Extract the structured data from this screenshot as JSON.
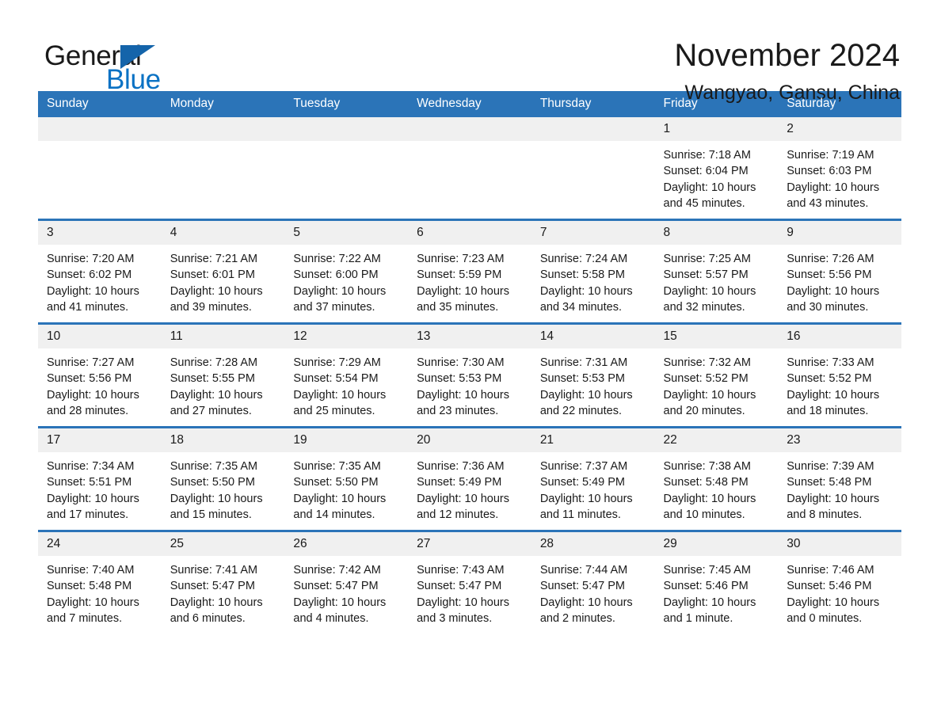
{
  "brand": {
    "word_one": "General",
    "word_two": "Blue",
    "triangle_color": "#1464aa",
    "blue_color": "#0b72c4",
    "icon": "triangle-logo-icon"
  },
  "header": {
    "title": "November 2024",
    "subtitle": "Wangyao, Gansu, China"
  },
  "theme": {
    "header_blue": "#2b74b8",
    "day_band_gray": "#f0f0f0",
    "text": "#1a1a1a"
  },
  "weekdays": [
    "Sunday",
    "Monday",
    "Tuesday",
    "Wednesday",
    "Thursday",
    "Friday",
    "Saturday"
  ],
  "weeks": [
    [
      {
        "day": "",
        "blank": true,
        "sunrise": "",
        "sunset": "",
        "daylight1": "",
        "daylight2": ""
      },
      {
        "day": "",
        "blank": true,
        "sunrise": "",
        "sunset": "",
        "daylight1": "",
        "daylight2": ""
      },
      {
        "day": "",
        "blank": true,
        "sunrise": "",
        "sunset": "",
        "daylight1": "",
        "daylight2": ""
      },
      {
        "day": "",
        "blank": true,
        "sunrise": "",
        "sunset": "",
        "daylight1": "",
        "daylight2": ""
      },
      {
        "day": "",
        "blank": true,
        "sunrise": "",
        "sunset": "",
        "daylight1": "",
        "daylight2": ""
      },
      {
        "day": "1",
        "blank": false,
        "sunrise": "Sunrise: 7:18 AM",
        "sunset": "Sunset: 6:04 PM",
        "daylight1": "Daylight: 10 hours",
        "daylight2": "and 45 minutes."
      },
      {
        "day": "2",
        "blank": false,
        "sunrise": "Sunrise: 7:19 AM",
        "sunset": "Sunset: 6:03 PM",
        "daylight1": "Daylight: 10 hours",
        "daylight2": "and 43 minutes."
      }
    ],
    [
      {
        "day": "3",
        "blank": false,
        "sunrise": "Sunrise: 7:20 AM",
        "sunset": "Sunset: 6:02 PM",
        "daylight1": "Daylight: 10 hours",
        "daylight2": "and 41 minutes."
      },
      {
        "day": "4",
        "blank": false,
        "sunrise": "Sunrise: 7:21 AM",
        "sunset": "Sunset: 6:01 PM",
        "daylight1": "Daylight: 10 hours",
        "daylight2": "and 39 minutes."
      },
      {
        "day": "5",
        "blank": false,
        "sunrise": "Sunrise: 7:22 AM",
        "sunset": "Sunset: 6:00 PM",
        "daylight1": "Daylight: 10 hours",
        "daylight2": "and 37 minutes."
      },
      {
        "day": "6",
        "blank": false,
        "sunrise": "Sunrise: 7:23 AM",
        "sunset": "Sunset: 5:59 PM",
        "daylight1": "Daylight: 10 hours",
        "daylight2": "and 35 minutes."
      },
      {
        "day": "7",
        "blank": false,
        "sunrise": "Sunrise: 7:24 AM",
        "sunset": "Sunset: 5:58 PM",
        "daylight1": "Daylight: 10 hours",
        "daylight2": "and 34 minutes."
      },
      {
        "day": "8",
        "blank": false,
        "sunrise": "Sunrise: 7:25 AM",
        "sunset": "Sunset: 5:57 PM",
        "daylight1": "Daylight: 10 hours",
        "daylight2": "and 32 minutes."
      },
      {
        "day": "9",
        "blank": false,
        "sunrise": "Sunrise: 7:26 AM",
        "sunset": "Sunset: 5:56 PM",
        "daylight1": "Daylight: 10 hours",
        "daylight2": "and 30 minutes."
      }
    ],
    [
      {
        "day": "10",
        "blank": false,
        "sunrise": "Sunrise: 7:27 AM",
        "sunset": "Sunset: 5:56 PM",
        "daylight1": "Daylight: 10 hours",
        "daylight2": "and 28 minutes."
      },
      {
        "day": "11",
        "blank": false,
        "sunrise": "Sunrise: 7:28 AM",
        "sunset": "Sunset: 5:55 PM",
        "daylight1": "Daylight: 10 hours",
        "daylight2": "and 27 minutes."
      },
      {
        "day": "12",
        "blank": false,
        "sunrise": "Sunrise: 7:29 AM",
        "sunset": "Sunset: 5:54 PM",
        "daylight1": "Daylight: 10 hours",
        "daylight2": "and 25 minutes."
      },
      {
        "day": "13",
        "blank": false,
        "sunrise": "Sunrise: 7:30 AM",
        "sunset": "Sunset: 5:53 PM",
        "daylight1": "Daylight: 10 hours",
        "daylight2": "and 23 minutes."
      },
      {
        "day": "14",
        "blank": false,
        "sunrise": "Sunrise: 7:31 AM",
        "sunset": "Sunset: 5:53 PM",
        "daylight1": "Daylight: 10 hours",
        "daylight2": "and 22 minutes."
      },
      {
        "day": "15",
        "blank": false,
        "sunrise": "Sunrise: 7:32 AM",
        "sunset": "Sunset: 5:52 PM",
        "daylight1": "Daylight: 10 hours",
        "daylight2": "and 20 minutes."
      },
      {
        "day": "16",
        "blank": false,
        "sunrise": "Sunrise: 7:33 AM",
        "sunset": "Sunset: 5:52 PM",
        "daylight1": "Daylight: 10 hours",
        "daylight2": "and 18 minutes."
      }
    ],
    [
      {
        "day": "17",
        "blank": false,
        "sunrise": "Sunrise: 7:34 AM",
        "sunset": "Sunset: 5:51 PM",
        "daylight1": "Daylight: 10 hours",
        "daylight2": "and 17 minutes."
      },
      {
        "day": "18",
        "blank": false,
        "sunrise": "Sunrise: 7:35 AM",
        "sunset": "Sunset: 5:50 PM",
        "daylight1": "Daylight: 10 hours",
        "daylight2": "and 15 minutes."
      },
      {
        "day": "19",
        "blank": false,
        "sunrise": "Sunrise: 7:35 AM",
        "sunset": "Sunset: 5:50 PM",
        "daylight1": "Daylight: 10 hours",
        "daylight2": "and 14 minutes."
      },
      {
        "day": "20",
        "blank": false,
        "sunrise": "Sunrise: 7:36 AM",
        "sunset": "Sunset: 5:49 PM",
        "daylight1": "Daylight: 10 hours",
        "daylight2": "and 12 minutes."
      },
      {
        "day": "21",
        "blank": false,
        "sunrise": "Sunrise: 7:37 AM",
        "sunset": "Sunset: 5:49 PM",
        "daylight1": "Daylight: 10 hours",
        "daylight2": "and 11 minutes."
      },
      {
        "day": "22",
        "blank": false,
        "sunrise": "Sunrise: 7:38 AM",
        "sunset": "Sunset: 5:48 PM",
        "daylight1": "Daylight: 10 hours",
        "daylight2": "and 10 minutes."
      },
      {
        "day": "23",
        "blank": false,
        "sunrise": "Sunrise: 7:39 AM",
        "sunset": "Sunset: 5:48 PM",
        "daylight1": "Daylight: 10 hours",
        "daylight2": "and 8 minutes."
      }
    ],
    [
      {
        "day": "24",
        "blank": false,
        "sunrise": "Sunrise: 7:40 AM",
        "sunset": "Sunset: 5:48 PM",
        "daylight1": "Daylight: 10 hours",
        "daylight2": "and 7 minutes."
      },
      {
        "day": "25",
        "blank": false,
        "sunrise": "Sunrise: 7:41 AM",
        "sunset": "Sunset: 5:47 PM",
        "daylight1": "Daylight: 10 hours",
        "daylight2": "and 6 minutes."
      },
      {
        "day": "26",
        "blank": false,
        "sunrise": "Sunrise: 7:42 AM",
        "sunset": "Sunset: 5:47 PM",
        "daylight1": "Daylight: 10 hours",
        "daylight2": "and 4 minutes."
      },
      {
        "day": "27",
        "blank": false,
        "sunrise": "Sunrise: 7:43 AM",
        "sunset": "Sunset: 5:47 PM",
        "daylight1": "Daylight: 10 hours",
        "daylight2": "and 3 minutes."
      },
      {
        "day": "28",
        "blank": false,
        "sunrise": "Sunrise: 7:44 AM",
        "sunset": "Sunset: 5:47 PM",
        "daylight1": "Daylight: 10 hours",
        "daylight2": "and 2 minutes."
      },
      {
        "day": "29",
        "blank": false,
        "sunrise": "Sunrise: 7:45 AM",
        "sunset": "Sunset: 5:46 PM",
        "daylight1": "Daylight: 10 hours",
        "daylight2": "and 1 minute."
      },
      {
        "day": "30",
        "blank": false,
        "sunrise": "Sunrise: 7:46 AM",
        "sunset": "Sunset: 5:46 PM",
        "daylight1": "Daylight: 10 hours",
        "daylight2": "and 0 minutes."
      }
    ]
  ]
}
